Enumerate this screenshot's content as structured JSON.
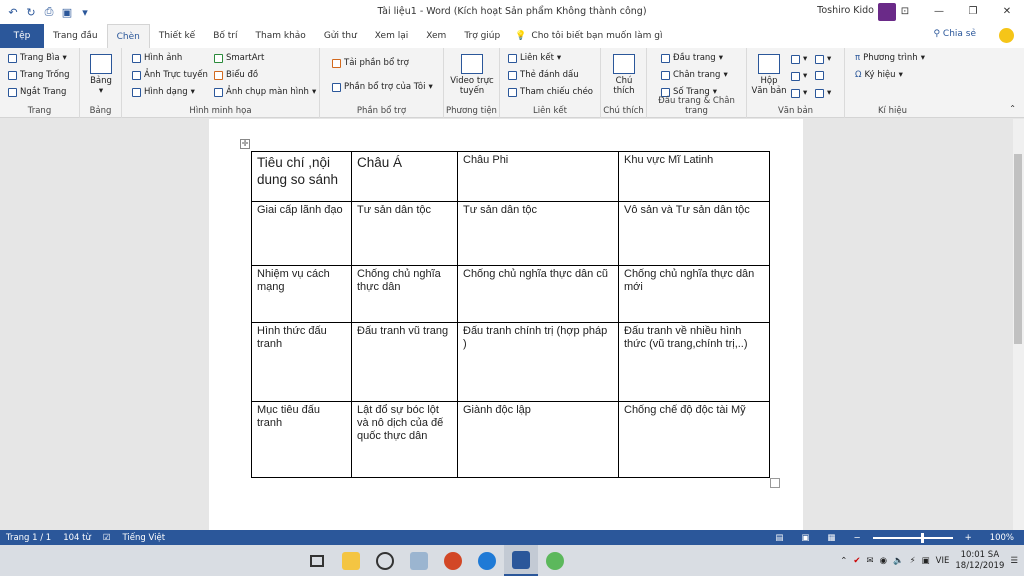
{
  "window": {
    "title": "Tài liệu1  -  Word (Kích hoạt Sản phẩm Không thành công)",
    "user": "Toshiro Kido"
  },
  "tabs": [
    {
      "label": "Tệp",
      "active": false
    },
    {
      "label": "Trang đầu",
      "active": false
    },
    {
      "label": "Chèn",
      "active": true
    },
    {
      "label": "Thiết kế",
      "active": false
    },
    {
      "label": "Bố trí",
      "active": false
    },
    {
      "label": "Tham khảo",
      "active": false
    },
    {
      "label": "Gửi thư",
      "active": false
    },
    {
      "label": "Xem lại",
      "active": false
    },
    {
      "label": "Xem",
      "active": false
    },
    {
      "label": "Trợ giúp",
      "active": false
    }
  ],
  "tellme": "Cho tôi biết bạn muốn làm gì",
  "share": "Chia sẻ",
  "ribbon": {
    "trang": {
      "name": "Trang",
      "items": [
        "Trang Bìa",
        "Trang Trống",
        "Ngắt Trang"
      ]
    },
    "bang": {
      "name": "Bảng",
      "label": "Bảng"
    },
    "minhhoa": {
      "name": "Hình minh họa",
      "items": [
        "Hình ảnh",
        "Ảnh Trực tuyến",
        "Hình dạng",
        "SmartArt",
        "Biểu đồ",
        "Ảnh chụp màn hình"
      ]
    },
    "phanbotro": {
      "name": "Phần bổ trợ",
      "items": [
        "Tải phần bổ trợ",
        "Phần bổ trợ của Tôi"
      ]
    },
    "phuongtien": {
      "name": "Phương tiện",
      "label": "Video trực tuyến"
    },
    "lienket": {
      "name": "Liên kết",
      "items": [
        "Liên kết",
        "Thẻ đánh dấu",
        "Tham chiếu chéo"
      ]
    },
    "chuthich": {
      "name": "Chú thích",
      "label": "Chú thích"
    },
    "dauchan": {
      "name": "Đầu trang & Chân trang",
      "items": [
        "Đầu trang",
        "Chân trang",
        "Số Trang"
      ]
    },
    "vanban": {
      "name": "Văn bản",
      "label": "Hộp Văn bản"
    },
    "kihieu": {
      "name": "Kí hiệu",
      "items": [
        "Phương trình",
        "Ký hiệu"
      ]
    }
  },
  "table": {
    "header": [
      "Tiêu chí ,nội dung so sánh",
      "Châu Á",
      "Châu Phi",
      "Khu vực Mĩ Latinh"
    ],
    "rows": [
      [
        "Giai cấp lãnh đạo",
        "Tư sản dân tộc",
        "Tư sản dân tộc",
        "Vô sản và Tư sản dân tộc"
      ],
      [
        "Nhiệm vụ cách mạng",
        "Chống chủ nghĩa thực dân",
        "Chống chủ nghĩa thực dân cũ",
        "Chống chủ nghĩa thực dân mới"
      ],
      [
        "Hình thức đấu tranh",
        "Đấu tranh vũ trang",
        "Đấu tranh chính trị (hợp pháp )",
        "Đấu tranh về nhiều hình thức (vũ trang,chính trị,..)"
      ],
      [
        "Mục tiêu đấu tranh",
        "Lật đổ sự bóc lột và nô dịch của đế quốc thực dân",
        "Giành độc lập",
        "Chống chế độ độc tài Mỹ"
      ]
    ]
  },
  "status": {
    "page": "Trang 1 / 1",
    "words": "104 từ",
    "lang": "Tiếng Việt",
    "zoom": "100%",
    "zoom_level": 1.0
  },
  "taskbar": {
    "lang": "VIE",
    "time": "10:01 SA",
    "date": "18/12/2019"
  },
  "colors": {
    "accent": "#2b579a",
    "ribbon": "#f3f3f3",
    "taskbar": "#d9dde3"
  }
}
